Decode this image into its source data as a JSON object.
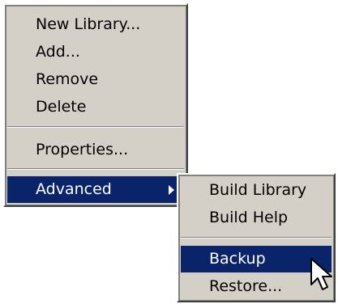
{
  "main_menu": {
    "items": [
      {
        "label": "New Library..."
      },
      {
        "label": "Add..."
      },
      {
        "label": "Remove"
      },
      {
        "label": "Delete"
      },
      {
        "label": "Properties..."
      },
      {
        "label": "Advanced"
      }
    ],
    "highlighted": "Advanced"
  },
  "advanced_submenu": {
    "items": [
      {
        "label": "Build Library"
      },
      {
        "label": "Build Help"
      },
      {
        "label": "Backup"
      },
      {
        "label": "Restore..."
      }
    ],
    "highlighted": "Backup"
  },
  "colors": {
    "menu_bg": "#d4d0c8",
    "highlight_bg": "#0a246a",
    "highlight_text": "#ffffff",
    "text": "#000000"
  },
  "icons": {
    "submenu_arrow": "chevron-right-icon",
    "cursor": "mouse-pointer-icon"
  }
}
